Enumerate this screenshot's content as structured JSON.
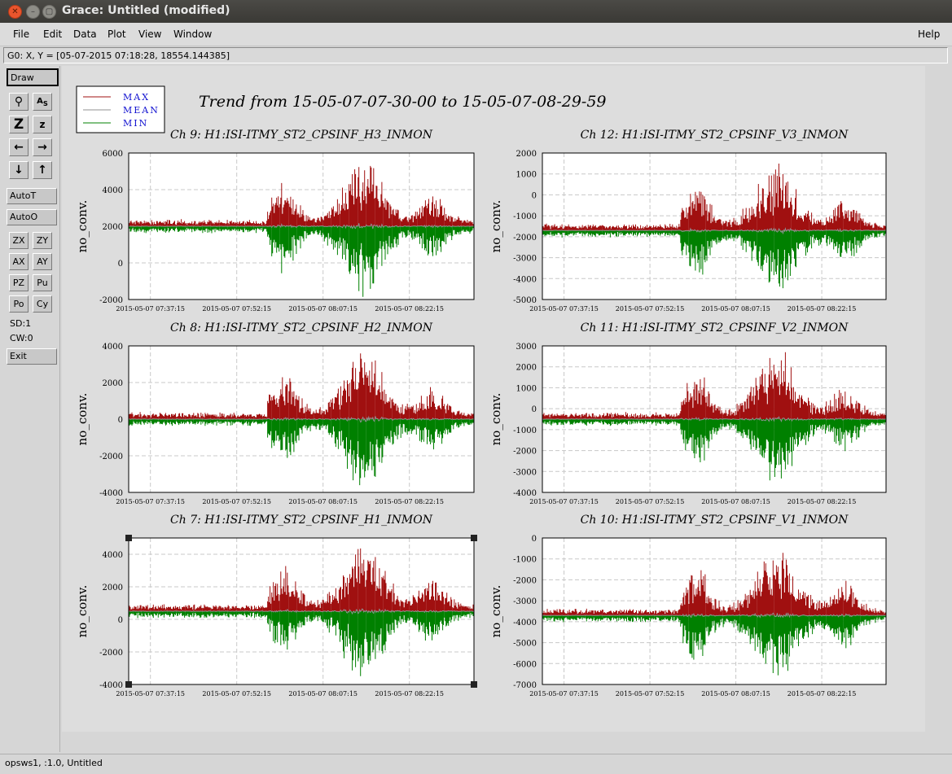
{
  "window": {
    "title": "Grace: Untitled (modified)"
  },
  "menu": {
    "file": "File",
    "edit": "Edit",
    "data": "Data",
    "plot": "Plot",
    "view": "View",
    "window": "Window",
    "help": "Help"
  },
  "locator": "G0: X, Y = [05-07-2015 07:18:28, 18554.144385]",
  "toolbar": {
    "draw": "Draw",
    "autot": "AutoT",
    "autoo": "AutoO",
    "zx": "ZX",
    "zy": "ZY",
    "ax": "AX",
    "ay": "AY",
    "pz": "PZ",
    "pu": "Pu",
    "po": "Po",
    "cy": "Cy",
    "sd": "SD:1",
    "cw": "CW:0",
    "exit": "Exit"
  },
  "status": "opsws1, :1.0, Untitled",
  "legend": [
    {
      "label": "MAX",
      "color": "#a01010"
    },
    {
      "label": "MEAN",
      "color": "#909090"
    },
    {
      "label": "MIN",
      "color": "#008000"
    }
  ],
  "chart_data": {
    "type": "line",
    "title": "Trend from 15-05-07-07-30-00 to 15-05-07-08-29-59",
    "x_ticks": [
      "2015-05-07 07:37:15",
      "2015-05-07 07:52:15",
      "2015-05-07 08:07:15",
      "2015-05-07 08:22:15"
    ],
    "panels": [
      {
        "title": "Ch 9: H1:ISI-ITMY_ST2_CPSINF_H3_INMON",
        "ylabel": "no_conv.",
        "ylim": [
          -2000,
          6000
        ],
        "yticks": [
          "6000",
          "4000",
          "2000",
          "0",
          "-2000"
        ],
        "baseline": 2000,
        "seed": 11
      },
      {
        "title": "Ch 12: H1:ISI-ITMY_ST2_CPSINF_V3_INMON",
        "ylabel": "no_conv.",
        "ylim": [
          -5000,
          2000
        ],
        "yticks": [
          "2000",
          "1000",
          "0",
          "-1000",
          "-2000",
          "-3000",
          "-4000",
          "-5000"
        ],
        "baseline": -1700,
        "seed": 23
      },
      {
        "title": "Ch 8: H1:ISI-ITMY_ST2_CPSINF_H2_INMON",
        "ylabel": "no_conv.",
        "ylim": [
          -4000,
          4000
        ],
        "yticks": [
          "4000",
          "2000",
          "0",
          "-2000",
          "-4000"
        ],
        "baseline": 0,
        "seed": 37
      },
      {
        "title": "Ch 11: H1:ISI-ITMY_ST2_CPSINF_V2_INMON",
        "ylabel": "no_conv.",
        "ylim": [
          -4000,
          3000
        ],
        "yticks": [
          "3000",
          "2000",
          "1000",
          "0",
          "-1000",
          "-2000",
          "-3000",
          "-4000"
        ],
        "baseline": -500,
        "seed": 41
      },
      {
        "title": "Ch 7: H1:ISI-ITMY_ST2_CPSINF_H1_INMON",
        "ylabel": "no_conv.",
        "ylim": [
          -4000,
          5000
        ],
        "yticks": [
          "4000",
          "2000",
          "0",
          "-2000",
          "-4000"
        ],
        "ytickvals": [
          4000,
          2000,
          0,
          -2000,
          -4000
        ],
        "baseline": 500,
        "seed": 53
      },
      {
        "title": "Ch 10: H1:ISI-ITMY_ST2_CPSINF_V1_INMON",
        "ylabel": "no_conv.",
        "ylim": [
          -7000,
          0
        ],
        "yticks": [
          "0",
          "-1000",
          "-2000",
          "-3000",
          "-4000",
          "-5000",
          "-6000",
          "-7000"
        ],
        "baseline": -3700,
        "seed": 67
      }
    ]
  }
}
